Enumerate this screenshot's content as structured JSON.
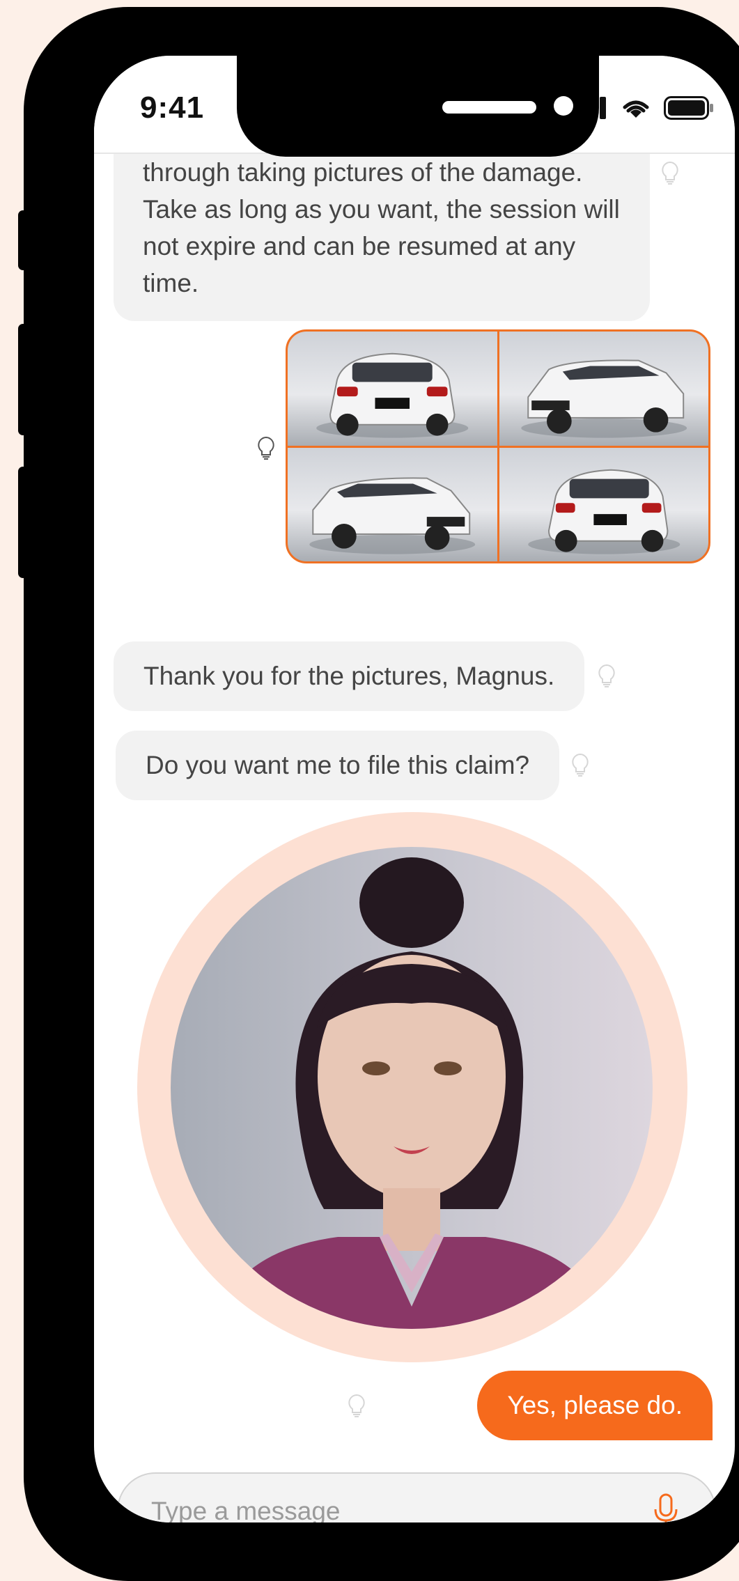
{
  "status_bar": {
    "time": "9:41"
  },
  "messages": [
    {
      "from": "assistant",
      "text_lines": [
        "through taking pictures of the damage.",
        "Take as long as you want, the session will",
        "not expire and can be resumed at any",
        "time."
      ]
    },
    {
      "from": "user",
      "type": "image-grid",
      "image_count": 4
    },
    {
      "from": "assistant",
      "text": "Thank you for the pictures, Magnus."
    },
    {
      "from": "assistant",
      "text": "Do you want me to file this claim?"
    },
    {
      "from": "assistant",
      "type": "avatar-video"
    },
    {
      "from": "user",
      "text": "Yes, please do."
    }
  ],
  "composer": {
    "placeholder": "Type a message"
  },
  "colors": {
    "accent": "#f66a1c",
    "bubble_bg": "#f2f2f2",
    "avatar_ring": "#fde0d3",
    "page_bg": "#fdf0e8"
  },
  "icons": [
    "signal-icon",
    "wifi-icon",
    "battery-icon",
    "lightbulb-icon",
    "microphone-icon"
  ]
}
